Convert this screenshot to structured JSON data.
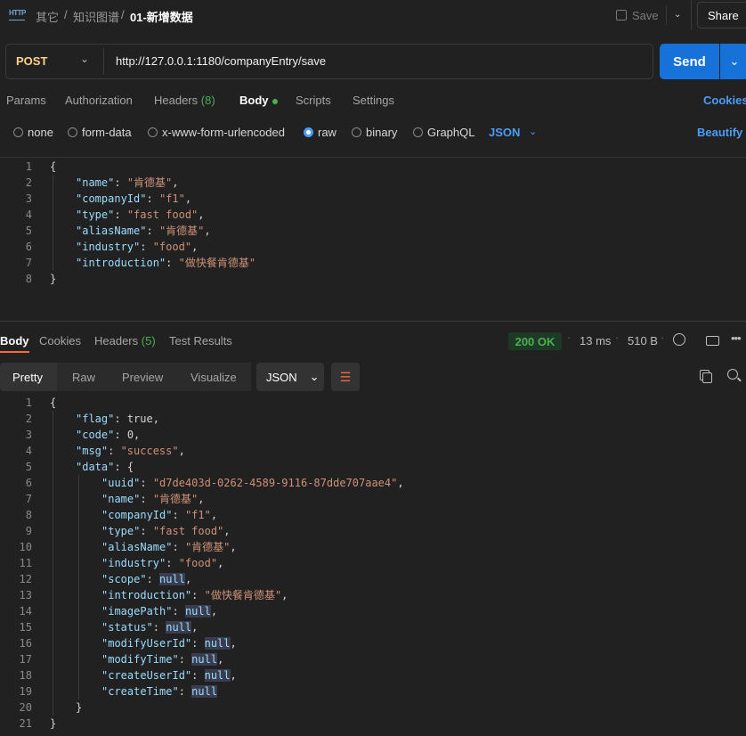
{
  "breadcrumb": [
    "其它",
    "知识图谱",
    "01-新增数据"
  ],
  "breadcrumb_sep": "/",
  "http_icon_text": "HTTP",
  "toolbar": {
    "save_label": "Save",
    "share_label": "Share"
  },
  "request": {
    "method": "POST",
    "url": "http://127.0.0.1:1180/companyEntry/save",
    "send_label": "Send"
  },
  "request_tabs": {
    "params": "Params",
    "authorization": "Authorization",
    "headers_label": "Headers",
    "headers_count": "(8)",
    "body": "Body",
    "scripts": "Scripts",
    "settings": "Settings",
    "cookies": "Cookies"
  },
  "body_types": {
    "none": "none",
    "form_data": "form-data",
    "urlencoded": "x-www-form-urlencoded",
    "raw": "raw",
    "binary": "binary",
    "graphql": "GraphQL",
    "selected": "raw",
    "format": "JSON",
    "beautify": "Beautify"
  },
  "request_body_lines": [
    {
      "n": "1",
      "t": "{"
    },
    {
      "n": "2",
      "k": "\"name\"",
      "v": "\"肯德基\"",
      "e": ","
    },
    {
      "n": "3",
      "k": "\"companyId\"",
      "v": "\"f1\"",
      "e": ","
    },
    {
      "n": "4",
      "k": "\"type\"",
      "v": "\"fast food\"",
      "e": ","
    },
    {
      "n": "5",
      "k": "\"aliasName\"",
      "v": "\"肯德基\"",
      "e": ","
    },
    {
      "n": "6",
      "k": "\"industry\"",
      "v": "\"food\"",
      "e": ","
    },
    {
      "n": "7",
      "k": "\"introduction\"",
      "v": "\"做快餐肯德基\"",
      "e": ""
    },
    {
      "n": "8",
      "t": "}"
    }
  ],
  "response_tabs": {
    "body": "Body",
    "cookies": "Cookies",
    "headers_label": "Headers",
    "headers_count": "(5)",
    "test_results": "Test Results"
  },
  "response_meta": {
    "status": "200 OK",
    "time": "13 ms",
    "size": "510 B"
  },
  "response_views": {
    "pretty": "Pretty",
    "raw": "Raw",
    "preview": "Preview",
    "visualize": "Visualize",
    "format": "JSON"
  },
  "response_body_lines": [
    {
      "n": "1",
      "t": "{",
      "ind": 0
    },
    {
      "n": "2",
      "k": "\"flag\"",
      "v": "true",
      "vt": "b",
      "e": ",",
      "ind": 1
    },
    {
      "n": "3",
      "k": "\"code\"",
      "v": "0",
      "vt": "b",
      "e": ",",
      "ind": 1
    },
    {
      "n": "4",
      "k": "\"msg\"",
      "v": "\"success\"",
      "vt": "s",
      "e": ",",
      "ind": 1
    },
    {
      "n": "5",
      "k": "\"data\"",
      "v": "{",
      "vt": "b",
      "e": "",
      "ind": 1
    },
    {
      "n": "6",
      "k": "\"uuid\"",
      "v": "\"d7de403d-0262-4589-9116-87dde707aae4\"",
      "vt": "s",
      "e": ",",
      "ind": 2
    },
    {
      "n": "7",
      "k": "\"name\"",
      "v": "\"肯德基\"",
      "vt": "s",
      "e": ",",
      "ind": 2
    },
    {
      "n": "8",
      "k": "\"companyId\"",
      "v": "\"f1\"",
      "vt": "s",
      "e": ",",
      "ind": 2
    },
    {
      "n": "9",
      "k": "\"type\"",
      "v": "\"fast food\"",
      "vt": "s",
      "e": ",",
      "ind": 2
    },
    {
      "n": "10",
      "k": "\"aliasName\"",
      "v": "\"肯德基\"",
      "vt": "s",
      "e": ",",
      "ind": 2
    },
    {
      "n": "11",
      "k": "\"industry\"",
      "v": "\"food\"",
      "vt": "s",
      "e": ",",
      "ind": 2
    },
    {
      "n": "12",
      "k": "\"scope\"",
      "v": "null",
      "vt": "nl",
      "e": ",",
      "ind": 2
    },
    {
      "n": "13",
      "k": "\"introduction\"",
      "v": "\"做快餐肯德基\"",
      "vt": "s",
      "e": ",",
      "ind": 2
    },
    {
      "n": "14",
      "k": "\"imagePath\"",
      "v": "null",
      "vt": "nl",
      "e": ",",
      "ind": 2
    },
    {
      "n": "15",
      "k": "\"status\"",
      "v": "null",
      "vt": "nl",
      "e": ",",
      "ind": 2
    },
    {
      "n": "16",
      "k": "\"modifyUserId\"",
      "v": "null",
      "vt": "nl",
      "e": ",",
      "ind": 2
    },
    {
      "n": "17",
      "k": "\"modifyTime\"",
      "v": "null",
      "vt": "nl",
      "e": ",",
      "ind": 2
    },
    {
      "n": "18",
      "k": "\"createUserId\"",
      "v": "null",
      "vt": "nl",
      "e": ",",
      "ind": 2
    },
    {
      "n": "19",
      "k": "\"createTime\"",
      "v": "null",
      "vt": "nl",
      "e": "",
      "ind": 2
    },
    {
      "n": "20",
      "t": "}",
      "ind": 1
    },
    {
      "n": "21",
      "t": "}",
      "ind": 0
    }
  ],
  "colors": {
    "accent": "#1672d9",
    "link": "#4a9df8",
    "method": "#ffd28a",
    "status_ok": "#4caf50",
    "json_key": "#9cdcfe",
    "json_string": "#ce9178"
  }
}
